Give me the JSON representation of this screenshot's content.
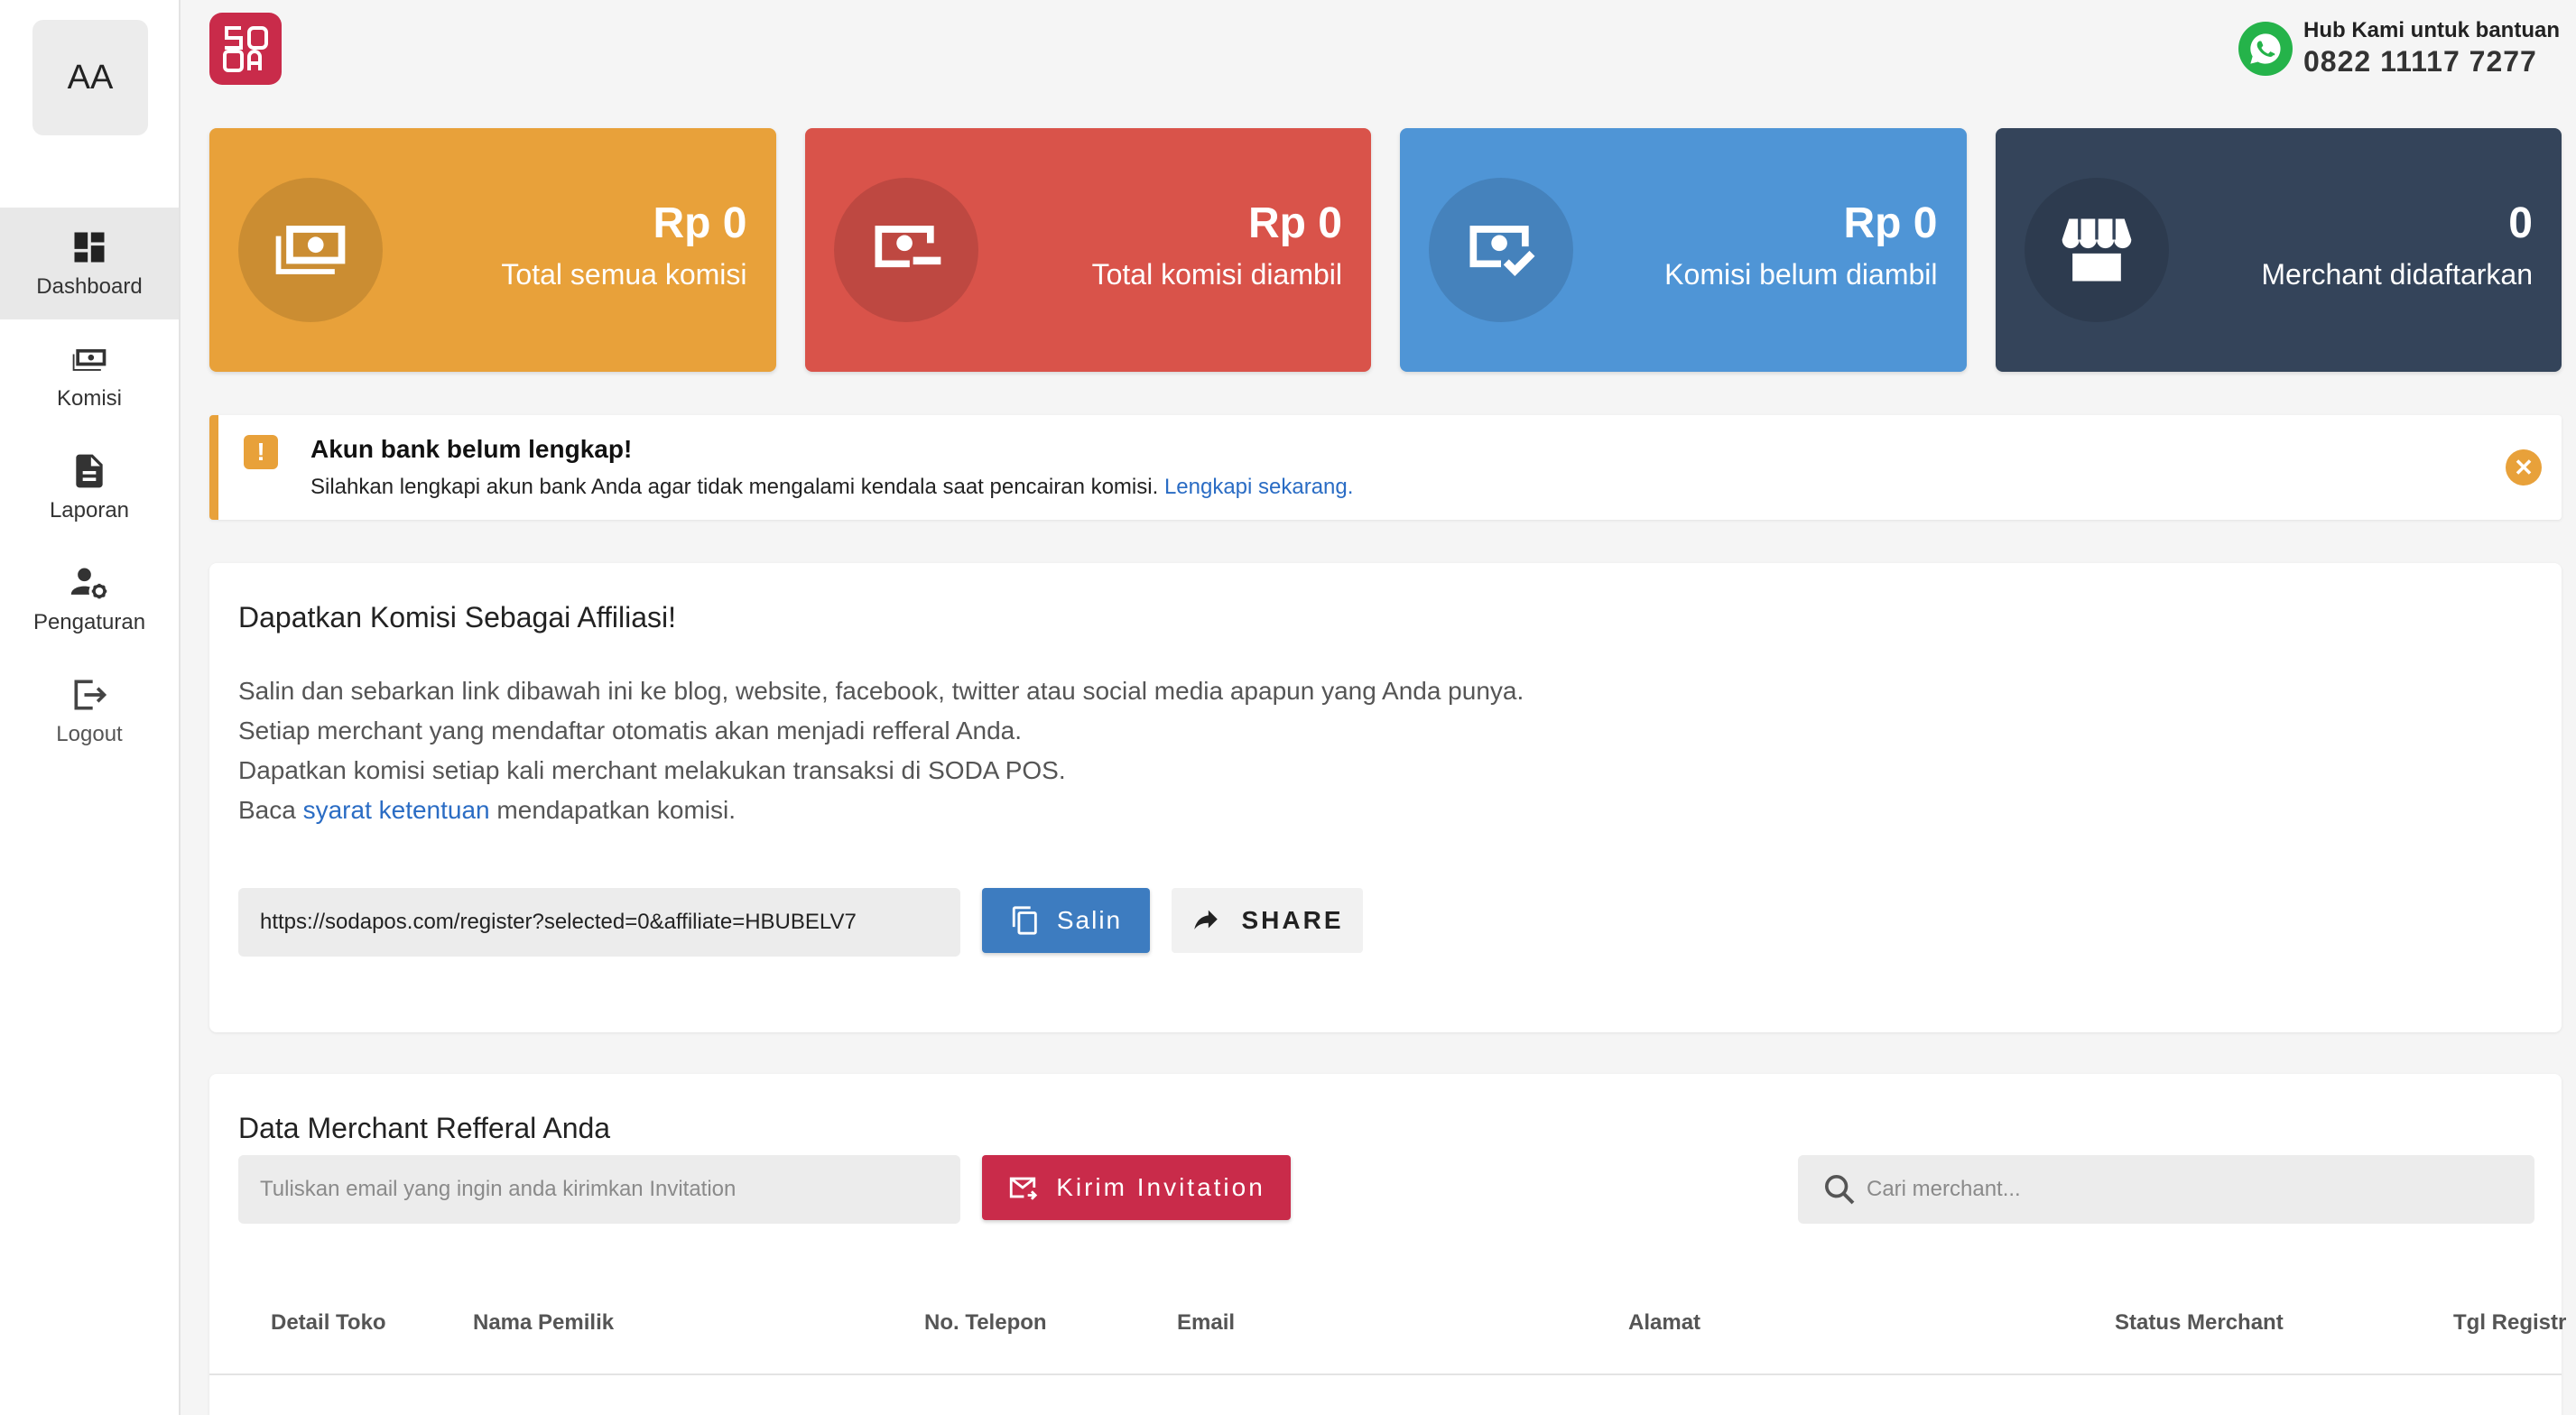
{
  "user": {
    "initials": "AA"
  },
  "sidebar": {
    "items": [
      {
        "label": "Dashboard",
        "icon": "dashboard-icon",
        "active": true
      },
      {
        "label": "Komisi",
        "icon": "money-icon"
      },
      {
        "label": "Laporan",
        "icon": "document-icon"
      },
      {
        "label": "Pengaturan",
        "icon": "user-settings-icon"
      },
      {
        "label": "Logout",
        "icon": "logout-icon"
      }
    ]
  },
  "header": {
    "help_label": "Hub Kami untuk bantuan",
    "help_phone": "0822 11117 7277"
  },
  "stats": [
    {
      "value": "Rp 0",
      "label": "Total semua komisi",
      "color": "#e8a13a",
      "icon": "money-stack-icon"
    },
    {
      "value": "Rp 0",
      "label": "Total komisi diambil",
      "color": "#d9534a",
      "icon": "money-minus-icon"
    },
    {
      "value": "Rp 0",
      "label": "Komisi belum diambil",
      "color": "#4f95d6",
      "icon": "money-check-icon"
    },
    {
      "value": "0",
      "label": "Merchant didaftarkan",
      "color": "#34445a",
      "icon": "store-icon"
    }
  ],
  "alert": {
    "title": "Akun bank belum lengkap!",
    "message": "Silahkan lengkapi akun bank Anda agar tidak mengalami kendala saat pencairan komisi.",
    "link": "Lengkapi sekarang."
  },
  "affiliate": {
    "title": "Dapatkan Komisi Sebagai Affiliasi!",
    "line1": "Salin dan sebarkan link dibawah ini ke blog, website, facebook, twitter atau social media apapun yang Anda punya.",
    "line2": "Setiap merchant yang mendaftar otomatis akan menjadi refferal Anda.",
    "line3": "Dapatkan komisi setiap kali merchant melakukan transaksi di SODA POS.",
    "line4_pre": "Baca",
    "line4_link": "syarat ketentuan",
    "line4_post": "mendapatkan komisi.",
    "link_value": "https://sodapos.com/register?selected=0&affiliate=HBUBELV7",
    "copy_label": "Salin",
    "share_label": "SHARE"
  },
  "merchants": {
    "title": "Data Merchant Refferal Anda",
    "email_placeholder": "Tuliskan email yang ingin anda kirimkan Invitation",
    "invite_label": "Kirim Invitation",
    "search_placeholder": "Cari merchant...",
    "columns": [
      "Detail Toko",
      "Nama Pemilik",
      "No. Telepon",
      "Email",
      "Alamat",
      "Status Merchant",
      "Tgl Registr"
    ]
  }
}
